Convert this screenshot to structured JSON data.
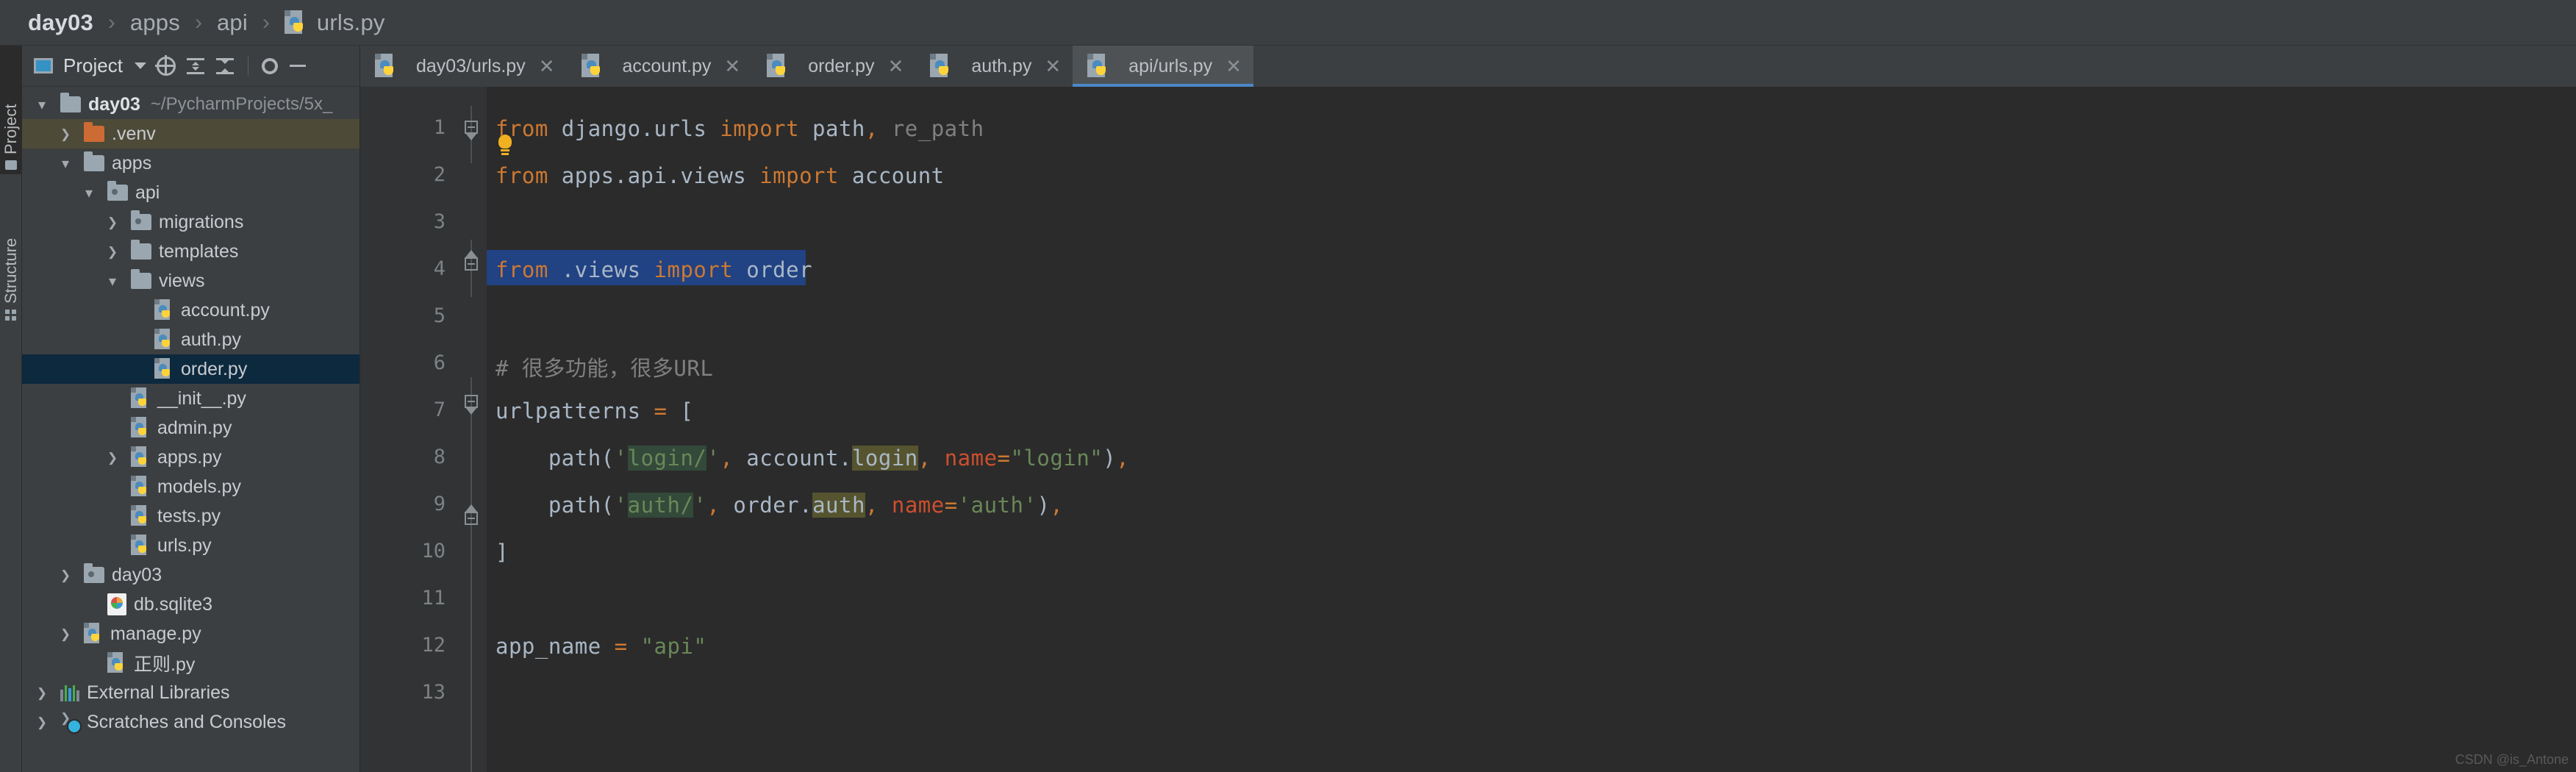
{
  "breadcrumb": {
    "items": [
      "day03",
      "apps",
      "api"
    ],
    "file": "urls.py",
    "separator": "›"
  },
  "toolstrip": {
    "project_label": "Project",
    "structure_label": "Structure"
  },
  "project_panel": {
    "title": "Project",
    "icons": [
      "window-icon",
      "chevron-down-icon",
      "locate-icon",
      "collapse-all-icon",
      "expand-all-icon",
      "gear-icon",
      "minimize-icon"
    ],
    "tree": [
      {
        "indent": 0,
        "arrow": "down",
        "icon": "folder",
        "name": "day03",
        "bold": true,
        "path": "~/PycharmProjects/5x_",
        "state": "none"
      },
      {
        "indent": 1,
        "arrow": "right",
        "icon": "folder-orange",
        "name": ".venv",
        "state": "sel-inactive"
      },
      {
        "indent": 1,
        "arrow": "down",
        "icon": "folder",
        "name": "apps",
        "state": "none"
      },
      {
        "indent": 2,
        "arrow": "down",
        "icon": "folder-module",
        "name": "api",
        "state": "none"
      },
      {
        "indent": 3,
        "arrow": "right",
        "icon": "folder-module",
        "name": "migrations",
        "state": "none"
      },
      {
        "indent": 3,
        "arrow": "right",
        "icon": "folder",
        "name": "templates",
        "state": "none"
      },
      {
        "indent": 3,
        "arrow": "down",
        "icon": "folder",
        "name": "views",
        "state": "none"
      },
      {
        "indent": 4,
        "arrow": "none",
        "icon": "python-file",
        "name": "account.py",
        "state": "none"
      },
      {
        "indent": 4,
        "arrow": "none",
        "icon": "python-file",
        "name": "auth.py",
        "state": "none"
      },
      {
        "indent": 4,
        "arrow": "none",
        "icon": "python-file",
        "name": "order.py",
        "state": "sel-active"
      },
      {
        "indent": 3,
        "arrow": "none",
        "icon": "python-file",
        "name": "__init__.py",
        "state": "none"
      },
      {
        "indent": 3,
        "arrow": "none",
        "icon": "python-file",
        "name": "admin.py",
        "state": "none"
      },
      {
        "indent": 3,
        "arrow": "right",
        "icon": "python-file",
        "name": "apps.py",
        "state": "none"
      },
      {
        "indent": 3,
        "arrow": "none",
        "icon": "python-file",
        "name": "models.py",
        "state": "none"
      },
      {
        "indent": 3,
        "arrow": "none",
        "icon": "python-file",
        "name": "tests.py",
        "state": "none"
      },
      {
        "indent": 3,
        "arrow": "none",
        "icon": "python-file",
        "name": "urls.py",
        "state": "none"
      },
      {
        "indent": 1,
        "arrow": "right",
        "icon": "folder-module",
        "name": "day03",
        "state": "none"
      },
      {
        "indent": 2,
        "arrow": "none",
        "icon": "sqlite-file",
        "name": "db.sqlite3",
        "state": "none"
      },
      {
        "indent": 1,
        "arrow": "right",
        "icon": "python-file",
        "name": "manage.py",
        "state": "none"
      },
      {
        "indent": 2,
        "arrow": "none",
        "icon": "python-file",
        "name": "正则.py",
        "state": "none"
      },
      {
        "indent": 0,
        "arrow": "right",
        "icon": "library",
        "name": "External Libraries",
        "state": "none"
      },
      {
        "indent": 0,
        "arrow": "right",
        "icon": "scratches",
        "name": "Scratches and Consoles",
        "state": "none"
      }
    ]
  },
  "editor": {
    "tabs": [
      {
        "label": "day03/urls.py",
        "active": false
      },
      {
        "label": "account.py",
        "active": false
      },
      {
        "label": "order.py",
        "active": false
      },
      {
        "label": "auth.py",
        "active": false
      },
      {
        "label": "api/urls.py",
        "active": true
      }
    ],
    "close_glyph": "✕",
    "line_numbers": [
      "1",
      "2",
      "3",
      "4",
      "5",
      "6",
      "7",
      "8",
      "9",
      "10",
      "11",
      "12",
      "13"
    ],
    "lines": [
      "from django.urls import path, re_path",
      "from apps.api.views import account",
      "",
      "from .views import order",
      "",
      "# 很多功能，很多URL",
      "urlpatterns = [",
      "    path('login/', account.login, name=\"login\"),",
      "    path('auth/', order.auth, name='auth'),",
      "]",
      "",
      "app_name = \"api\"",
      ""
    ],
    "selected_line": 4,
    "selected_text": "from .views import order",
    "intention_bulb": "lightbulb-icon"
  },
  "watermark": "CSDN @is_Antone",
  "colors": {
    "keyword": "#cc7832",
    "string": "#6a8759",
    "comment": "#808080",
    "kwarg": "#cc4f2e",
    "text": "#a9b7c6",
    "selection": "#214283",
    "tab_accent": "#4a88c7",
    "tree_selected": "#0d293e",
    "tree_inactive": "#4e4a38",
    "editor_bg": "#2b2b2b",
    "panel_bg": "#3c3f41",
    "gutter_bg": "#313335",
    "usage_read": "#33493a",
    "usage_write": "#55542f"
  }
}
